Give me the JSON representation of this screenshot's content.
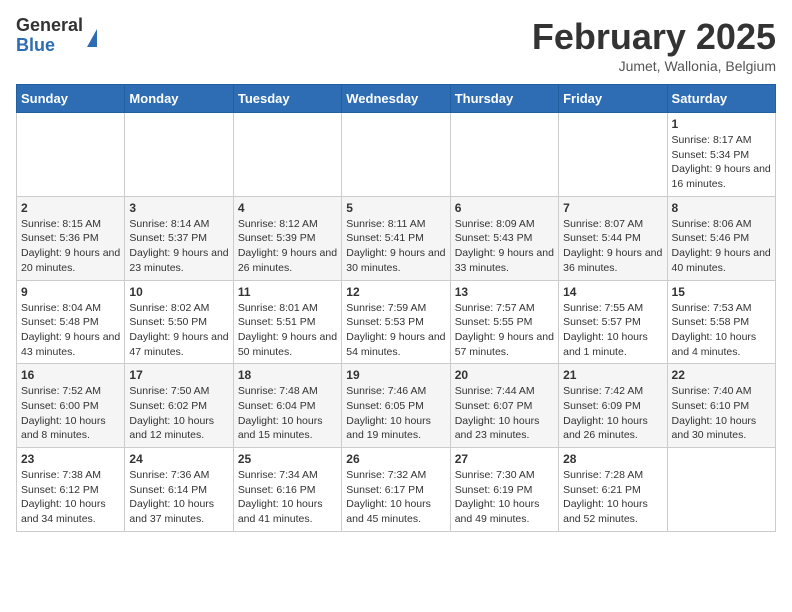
{
  "logo": {
    "general": "General",
    "blue": "Blue"
  },
  "header": {
    "month": "February 2025",
    "location": "Jumet, Wallonia, Belgium"
  },
  "days_of_week": [
    "Sunday",
    "Monday",
    "Tuesday",
    "Wednesday",
    "Thursday",
    "Friday",
    "Saturday"
  ],
  "weeks": [
    [
      {
        "day": "",
        "info": ""
      },
      {
        "day": "",
        "info": ""
      },
      {
        "day": "",
        "info": ""
      },
      {
        "day": "",
        "info": ""
      },
      {
        "day": "",
        "info": ""
      },
      {
        "day": "",
        "info": ""
      },
      {
        "day": "1",
        "info": "Sunrise: 8:17 AM\nSunset: 5:34 PM\nDaylight: 9 hours and 16 minutes."
      }
    ],
    [
      {
        "day": "2",
        "info": "Sunrise: 8:15 AM\nSunset: 5:36 PM\nDaylight: 9 hours and 20 minutes."
      },
      {
        "day": "3",
        "info": "Sunrise: 8:14 AM\nSunset: 5:37 PM\nDaylight: 9 hours and 23 minutes."
      },
      {
        "day": "4",
        "info": "Sunrise: 8:12 AM\nSunset: 5:39 PM\nDaylight: 9 hours and 26 minutes."
      },
      {
        "day": "5",
        "info": "Sunrise: 8:11 AM\nSunset: 5:41 PM\nDaylight: 9 hours and 30 minutes."
      },
      {
        "day": "6",
        "info": "Sunrise: 8:09 AM\nSunset: 5:43 PM\nDaylight: 9 hours and 33 minutes."
      },
      {
        "day": "7",
        "info": "Sunrise: 8:07 AM\nSunset: 5:44 PM\nDaylight: 9 hours and 36 minutes."
      },
      {
        "day": "8",
        "info": "Sunrise: 8:06 AM\nSunset: 5:46 PM\nDaylight: 9 hours and 40 minutes."
      }
    ],
    [
      {
        "day": "9",
        "info": "Sunrise: 8:04 AM\nSunset: 5:48 PM\nDaylight: 9 hours and 43 minutes."
      },
      {
        "day": "10",
        "info": "Sunrise: 8:02 AM\nSunset: 5:50 PM\nDaylight: 9 hours and 47 minutes."
      },
      {
        "day": "11",
        "info": "Sunrise: 8:01 AM\nSunset: 5:51 PM\nDaylight: 9 hours and 50 minutes."
      },
      {
        "day": "12",
        "info": "Sunrise: 7:59 AM\nSunset: 5:53 PM\nDaylight: 9 hours and 54 minutes."
      },
      {
        "day": "13",
        "info": "Sunrise: 7:57 AM\nSunset: 5:55 PM\nDaylight: 9 hours and 57 minutes."
      },
      {
        "day": "14",
        "info": "Sunrise: 7:55 AM\nSunset: 5:57 PM\nDaylight: 10 hours and 1 minute."
      },
      {
        "day": "15",
        "info": "Sunrise: 7:53 AM\nSunset: 5:58 PM\nDaylight: 10 hours and 4 minutes."
      }
    ],
    [
      {
        "day": "16",
        "info": "Sunrise: 7:52 AM\nSunset: 6:00 PM\nDaylight: 10 hours and 8 minutes."
      },
      {
        "day": "17",
        "info": "Sunrise: 7:50 AM\nSunset: 6:02 PM\nDaylight: 10 hours and 12 minutes."
      },
      {
        "day": "18",
        "info": "Sunrise: 7:48 AM\nSunset: 6:04 PM\nDaylight: 10 hours and 15 minutes."
      },
      {
        "day": "19",
        "info": "Sunrise: 7:46 AM\nSunset: 6:05 PM\nDaylight: 10 hours and 19 minutes."
      },
      {
        "day": "20",
        "info": "Sunrise: 7:44 AM\nSunset: 6:07 PM\nDaylight: 10 hours and 23 minutes."
      },
      {
        "day": "21",
        "info": "Sunrise: 7:42 AM\nSunset: 6:09 PM\nDaylight: 10 hours and 26 minutes."
      },
      {
        "day": "22",
        "info": "Sunrise: 7:40 AM\nSunset: 6:10 PM\nDaylight: 10 hours and 30 minutes."
      }
    ],
    [
      {
        "day": "23",
        "info": "Sunrise: 7:38 AM\nSunset: 6:12 PM\nDaylight: 10 hours and 34 minutes."
      },
      {
        "day": "24",
        "info": "Sunrise: 7:36 AM\nSunset: 6:14 PM\nDaylight: 10 hours and 37 minutes."
      },
      {
        "day": "25",
        "info": "Sunrise: 7:34 AM\nSunset: 6:16 PM\nDaylight: 10 hours and 41 minutes."
      },
      {
        "day": "26",
        "info": "Sunrise: 7:32 AM\nSunset: 6:17 PM\nDaylight: 10 hours and 45 minutes."
      },
      {
        "day": "27",
        "info": "Sunrise: 7:30 AM\nSunset: 6:19 PM\nDaylight: 10 hours and 49 minutes."
      },
      {
        "day": "28",
        "info": "Sunrise: 7:28 AM\nSunset: 6:21 PM\nDaylight: 10 hours and 52 minutes."
      },
      {
        "day": "",
        "info": ""
      }
    ]
  ]
}
